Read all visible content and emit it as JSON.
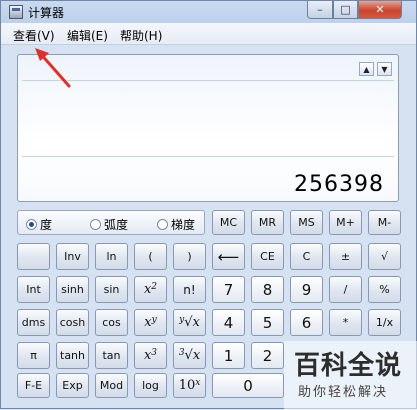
{
  "window": {
    "title": "计算器",
    "close_glyph": "✕",
    "min_glyph": "–",
    "max_glyph": "□"
  },
  "menu": {
    "view": "查看(V)",
    "edit": "编辑(E)",
    "help": "帮助(H)"
  },
  "display": {
    "value": "256398",
    "scroll_up": "▲",
    "scroll_down": "▼"
  },
  "angle_modes": {
    "degree": "度",
    "radian": "弧度",
    "gradian": "梯度",
    "selected": "degree"
  },
  "keys": {
    "mc": "MC",
    "mr": "MR",
    "ms": "MS",
    "mplus": "M+",
    "mminus": "M-",
    "inv": "Inv",
    "ln": "ln",
    "lparen": "(",
    "rparen": ")",
    "backspace": "⟵",
    "ce": "CE",
    "c": "C",
    "plusminus": "±",
    "sqrt": "√",
    "int": "Int",
    "sinh": "sinh",
    "sin": "sin",
    "x2_base": "x",
    "x2_exp": "2",
    "factorial": "n!",
    "n7": "7",
    "n8": "8",
    "n9": "9",
    "divide": "/",
    "percent": "%",
    "dms": "dms",
    "cosh": "cosh",
    "cos": "cos",
    "xy_base": "x",
    "xy_exp": "y",
    "yroot_pre": "y",
    "yroot_sym": "√x",
    "n4": "4",
    "n5": "5",
    "n6": "6",
    "multiply": "*",
    "reciprocal": "1/x",
    "pi": "π",
    "tanh": "tanh",
    "tan": "tan",
    "x3_base": "x",
    "x3_exp": "3",
    "cuberoot_pre": "3",
    "cuberoot_sym": "√x",
    "n1": "1",
    "n2": "2",
    "fe": "F-E",
    "exp": "Exp",
    "mod": "Mod",
    "log": "log",
    "tenx_base": "10",
    "tenx_exp": "x",
    "n0": "0"
  },
  "watermark": {
    "main": "百科全说",
    "sub": "助你轻松解决"
  },
  "colors": {
    "annotation_arrow": "#e0302a"
  }
}
